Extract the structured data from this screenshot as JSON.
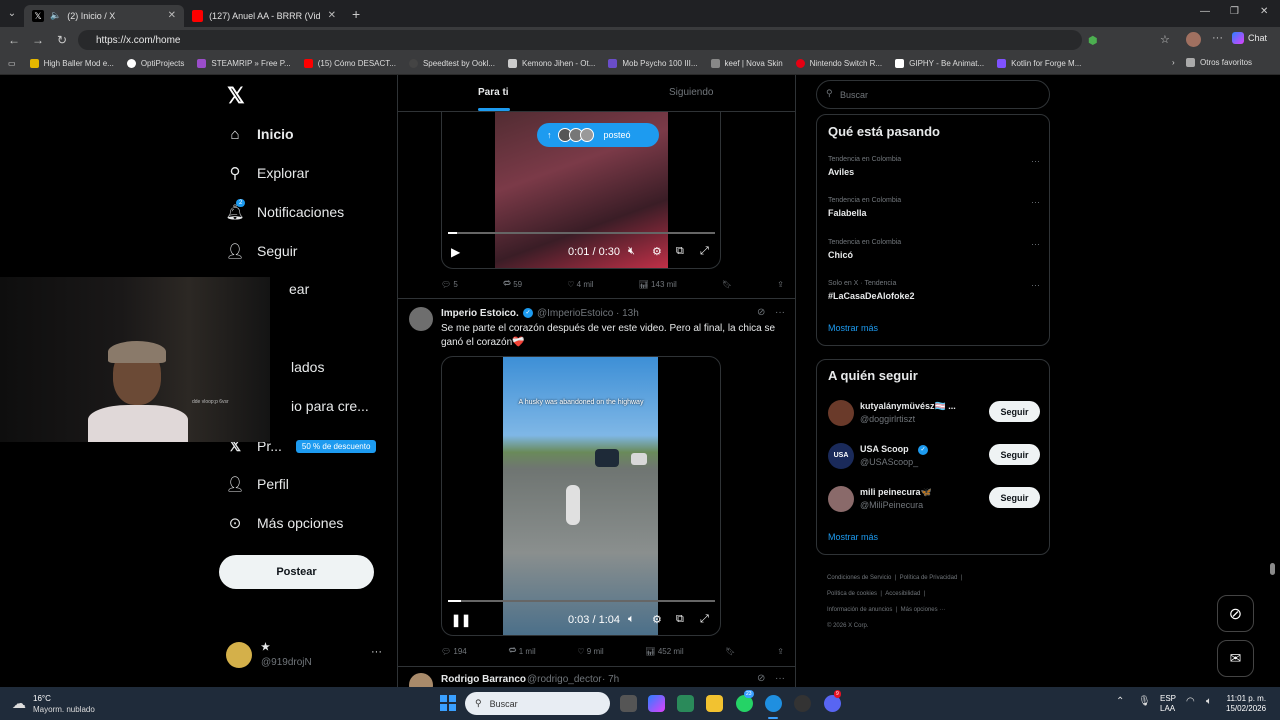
{
  "browser": {
    "tabs": [
      {
        "title": "(2) Inicio / X"
      },
      {
        "title": "(127) Anuel AA - BRRR (Video Ofic"
      }
    ],
    "url": "https://x.com/home",
    "bookmarks": [
      "High Baller Mod e...",
      "OptiProjects",
      "STEAMRIP » Free P...",
      "(15) Cómo DESACT...",
      "Speedtest by Ookl...",
      "Kemono Jihen - Ot...",
      "Mob Psycho 100 III...",
      "keef | Nova Skin",
      "Nintendo Switch R...",
      "GIPHY - Be Animat...",
      "Kotlin for Forge M..."
    ],
    "other_bookmarks": "Otros favoritos",
    "chat_label": "Chat"
  },
  "nav": {
    "items": [
      {
        "label": "Inicio"
      },
      {
        "label": "Explorar"
      },
      {
        "label": "Notificaciones",
        "badge": "2"
      },
      {
        "label": "Seguir"
      },
      {
        "label": "ear"
      },
      {
        "label": "lados"
      },
      {
        "label": "io para cre..."
      },
      {
        "label": "Pr..."
      },
      {
        "label": "Perfil"
      },
      {
        "label": "Más opciones"
      }
    ],
    "premium_badge": "50 % de descuento",
    "post_button": "Postear",
    "account": {
      "name": "★",
      "handle": "@919drojN"
    }
  },
  "overlay": {
    "text": "dde vloop;p 6vsr"
  },
  "feed": {
    "tabs": [
      "Para ti",
      "Siguiendo"
    ],
    "new_posts_label": "posteó",
    "video1": {
      "time": "0:01 / 0:30",
      "progress": 0.033
    },
    "post1_actions": {
      "replies": "5",
      "reposts": "59",
      "likes": "4 mil",
      "views": "143 mil"
    },
    "post2": {
      "name": "Imperio Estoico.",
      "handle": "@ImperioEstoico",
      "time": "· 13h",
      "text": "Se me parte el corazón después de ver este video. Pero al final, la chica se ganó el corazón❤️‍🩹",
      "video_caption": "A husky was abandoned on the highway",
      "video_time": "0:03 / 1:04",
      "progress": 0.047,
      "actions": {
        "replies": "194",
        "reposts": "1 mil",
        "likes": "9 mil",
        "views": "452 mil"
      }
    },
    "post3": {
      "name": "Rodrigo Barranco",
      "handle": "@rodrigo_dector",
      "time": "· 7h"
    }
  },
  "sidebar": {
    "search_placeholder": "Buscar",
    "trending_title": "Qué está pasando",
    "trends": [
      {
        "context": "Tendencia en Colombia",
        "name": "Aviles"
      },
      {
        "context": "Tendencia en Colombia",
        "name": "Falabella"
      },
      {
        "context": "Tendencia en Colombia",
        "name": "Chicó"
      },
      {
        "context": "Solo en X · Tendencia",
        "name": "#LaCasaDeAlofoke2"
      }
    ],
    "show_more": "Mostrar más",
    "follow_title": "A quién seguir",
    "follows": [
      {
        "name": "kutyalánymüvész🏳️‍⚧️ ...",
        "handle": "@doggirlrtiszt",
        "button": "Seguir"
      },
      {
        "name": "USA Scoop",
        "handle": "@USAScoop_",
        "button": "Seguir"
      },
      {
        "name": "mili peinecura🦋",
        "handle": "@MiliPeinecura",
        "button": "Seguir"
      }
    ],
    "footer": [
      "Condiciones de Servicio",
      "Política de Privacidad",
      "Política de cookies",
      "Accesibilidad",
      "Información de anuncios",
      "Más opciones ···",
      "© 2026 X Corp."
    ]
  },
  "taskbar": {
    "weather_temp": "16°C",
    "weather_desc": "Mayorm. nublado",
    "search": "Buscar",
    "lang": "ESP",
    "lang2": "LAA",
    "time": "11:01 p. m.",
    "date": "15/02/2026",
    "badge1": "23",
    "badge2": "9"
  },
  "colors": {
    "accent": "#1d9bf0",
    "bg": "#000000",
    "border": "#2f3336",
    "muted": "#71767b"
  }
}
